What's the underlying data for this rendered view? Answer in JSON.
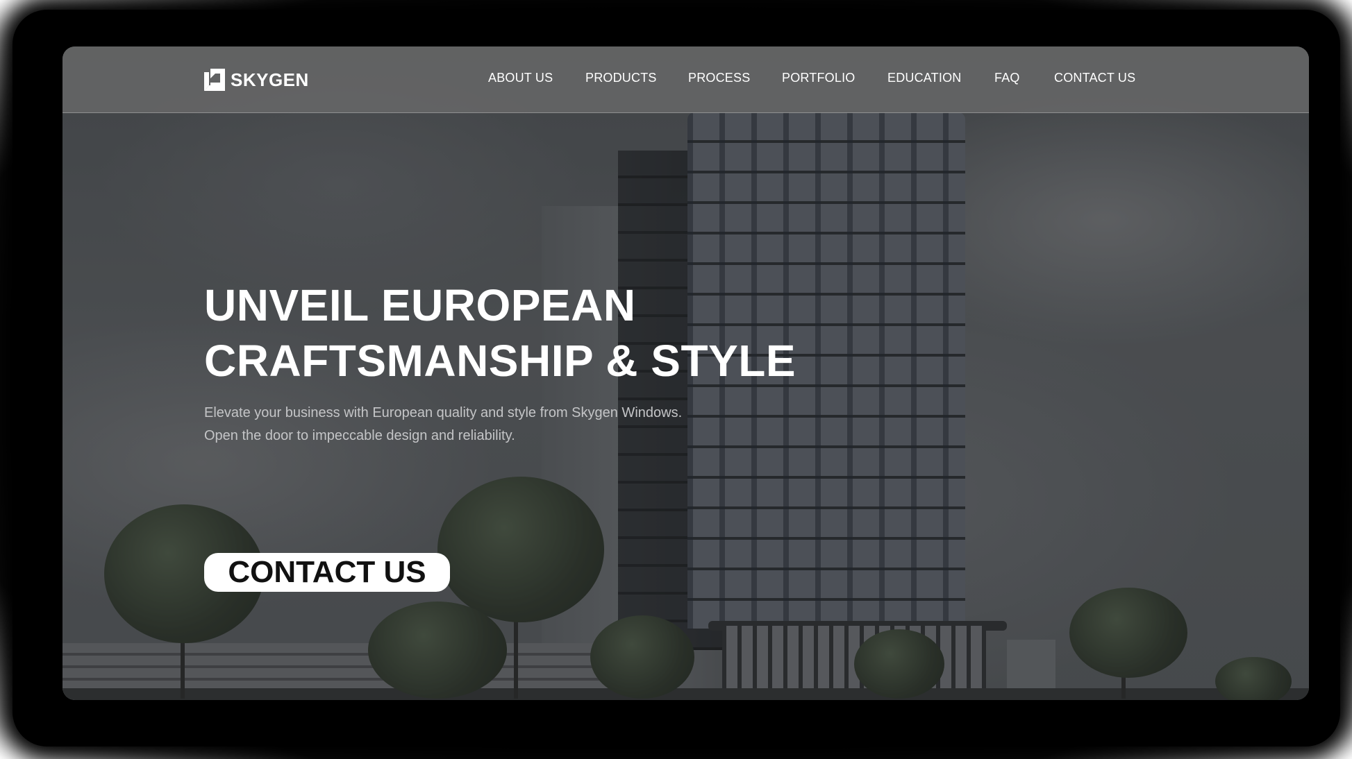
{
  "brand": {
    "name": "SKYGEN",
    "logo_icon": "skygen-window-logo-icon"
  },
  "nav": {
    "items": [
      {
        "label": "ABOUT US"
      },
      {
        "label": "PRODUCTS"
      },
      {
        "label": "PROCESS"
      },
      {
        "label": "PORTFOLIO"
      },
      {
        "label": "EDUCATION"
      },
      {
        "label": "FAQ"
      },
      {
        "label": "CONTACT US"
      }
    ]
  },
  "hero": {
    "title_line1": "UNVEIL EUROPEAN",
    "title_line2": "CRAFTSMANSHIP & STYLE",
    "subtitle_line1": "Elevate your business with European quality and style from Skygen Windows.",
    "subtitle_line2": "Open the door to impeccable design and reliability.",
    "cta_label": "CONTACT US",
    "background_image": "modern glass office tower with trees"
  },
  "colors": {
    "header_bg": "#6e6e6e",
    "text_primary": "#ffffff",
    "text_secondary": "#c4c5c7",
    "cta_bg": "#ffffff",
    "cta_text": "#111111"
  }
}
